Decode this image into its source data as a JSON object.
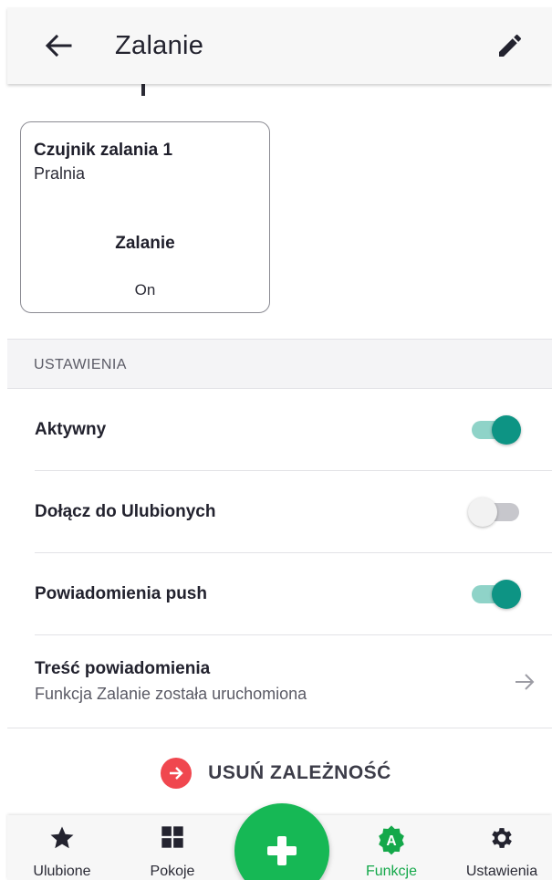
{
  "header": {
    "title": "Zalanie",
    "back_icon": "arrow-left-icon",
    "edit_icon": "pencil-icon"
  },
  "card": {
    "device_name": "Czujnik zalania 1",
    "room": "Pralnia",
    "function": "Zalanie",
    "state": "On"
  },
  "settings": {
    "section_title": "USTAWIENIA",
    "active": {
      "label": "Aktywny",
      "value": true
    },
    "favorites": {
      "label": "Dołącz do Ulubionych",
      "value": false
    },
    "push": {
      "label": "Powiadomienia push",
      "value": true
    },
    "notification": {
      "label": "Treść powiadomienia",
      "value": "Funkcja Zalanie została uruchomiona"
    }
  },
  "remove": {
    "label": "USUŃ ZALEŻNOŚĆ",
    "color": "#f0474f"
  },
  "bottom_nav": {
    "items": [
      {
        "label": "Ulubione",
        "icon": "star-icon",
        "active": false
      },
      {
        "label": "Pokoje",
        "icon": "grid-icon",
        "active": false
      },
      {
        "label": "Funkcje",
        "icon": "function-badge-icon",
        "active": true
      },
      {
        "label": "Ustawienia",
        "icon": "gear-icon",
        "active": false
      }
    ],
    "fab_icon": "plus-icon"
  },
  "colors": {
    "accent_toggle": "#0d9484",
    "fab": "#16b855",
    "active_nav": "#14a84a"
  }
}
